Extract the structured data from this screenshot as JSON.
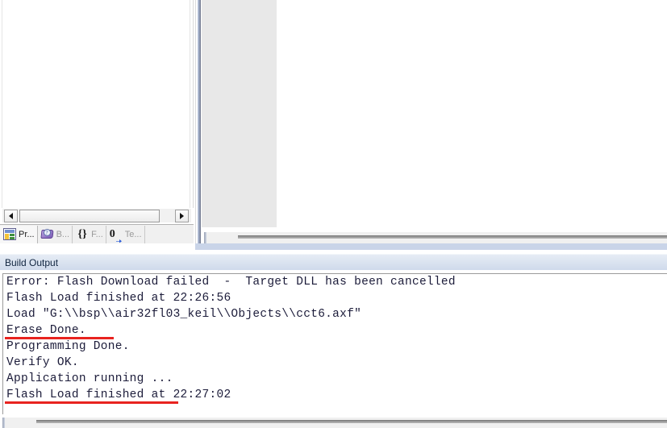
{
  "project_pane": {
    "tabs": [
      {
        "label": "Pr...",
        "full": "Project",
        "icon": "project-icon",
        "active": true
      },
      {
        "label": "B...",
        "full": "Books",
        "icon": "books-icon",
        "active": false
      },
      {
        "label": "F...",
        "full": "Functions",
        "icon": "functions-braces-icon",
        "active": false
      },
      {
        "label": "Te...",
        "full": "Templates",
        "icon": "templates-zero-arrow-icon",
        "active": false
      }
    ],
    "scrollbar": {
      "left_arrow": "◄",
      "right_arrow": "►"
    }
  },
  "build_output": {
    "title": "Build Output",
    "lines": [
      {
        "text": "Error: Flash Download failed  -  Target DLL has been cancelled",
        "underlined": false
      },
      {
        "text": "Flash Load finished at 22:26:56",
        "underlined": false
      },
      {
        "text": "Load \"G:\\\\bsp\\\\air32fl03_keil\\\\Objects\\\\cct6.axf\"",
        "underlined": false
      },
      {
        "text": "Erase Done.",
        "underlined": true
      },
      {
        "text": "Programming Done.",
        "underlined": false
      },
      {
        "text": "Verify OK.",
        "underlined": false
      },
      {
        "text": "Application running ...",
        "underlined": true
      },
      {
        "text": "Flash Load finished at 22:27:02",
        "underlined": false
      }
    ],
    "annotation_color": "#e8231f",
    "text_color": "#1c1c3a"
  },
  "colors": {
    "title_bar_top": "#e6ecf5",
    "title_bar_bottom": "#cfdaeb",
    "editor_doc_bg": "#e8e8e8",
    "splitter": "#8d99b4",
    "tab_bar_bg": "#f0f0f0"
  }
}
